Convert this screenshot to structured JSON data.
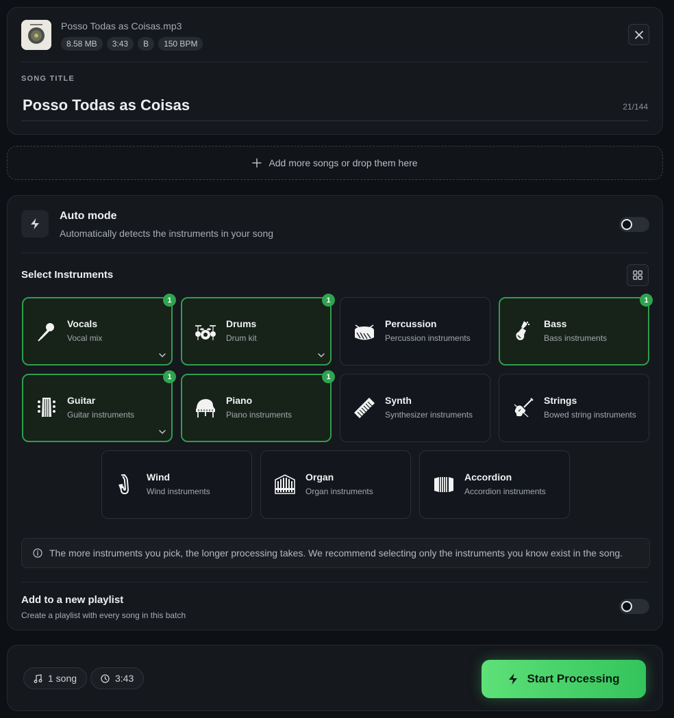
{
  "file": {
    "filename": "Posso Todas as Coisas.mp3",
    "size": "8.58 MB",
    "duration": "3:43",
    "key": "B",
    "bpm": "150 BPM"
  },
  "song_title": {
    "label": "SONG TITLE",
    "value": "Posso Todas as Coisas",
    "char_count": "21/144"
  },
  "drop_zone": {
    "label": "Add more songs or drop them here"
  },
  "auto_mode": {
    "title": "Auto mode",
    "description": "Automatically detects the instruments in your song",
    "enabled": false
  },
  "instruments_section": {
    "title": "Select Instruments"
  },
  "instruments": [
    {
      "name": "Vocals",
      "desc": "Vocal mix",
      "selected": true,
      "count": "1",
      "expandable": true
    },
    {
      "name": "Drums",
      "desc": "Drum kit",
      "selected": true,
      "count": "1",
      "expandable": true
    },
    {
      "name": "Percussion",
      "desc": "Percussion instruments",
      "selected": false
    },
    {
      "name": "Bass",
      "desc": "Bass instruments",
      "selected": true,
      "count": "1"
    },
    {
      "name": "Guitar",
      "desc": "Guitar instruments",
      "selected": true,
      "count": "1",
      "expandable": true
    },
    {
      "name": "Piano",
      "desc": "Piano instruments",
      "selected": true,
      "count": "1"
    },
    {
      "name": "Synth",
      "desc": "Synthesizer instruments",
      "selected": false
    },
    {
      "name": "Strings",
      "desc": "Bowed string instruments",
      "selected": false
    },
    {
      "name": "Wind",
      "desc": "Wind instruments",
      "selected": false
    },
    {
      "name": "Organ",
      "desc": "Organ instruments",
      "selected": false
    },
    {
      "name": "Accordion",
      "desc": "Accordion instruments",
      "selected": false
    }
  ],
  "info": {
    "text": "The more instruments you pick, the longer processing takes. We recommend selecting only the instruments you know exist in the song."
  },
  "playlist": {
    "title": "Add to a new playlist",
    "description": "Create a playlist with every song in this batch",
    "enabled": false
  },
  "footer": {
    "song_count": "1 song",
    "total_duration": "3:43",
    "start_label": "Start Processing"
  },
  "colors": {
    "accent": "#2ea44f",
    "button_start": "#5ee078",
    "button_end": "#33c45b"
  }
}
